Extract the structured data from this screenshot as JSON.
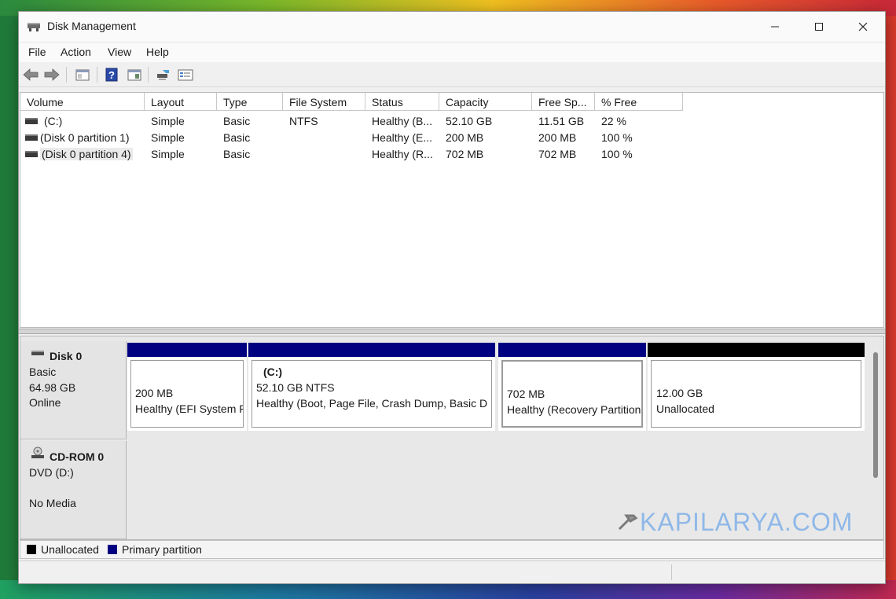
{
  "window": {
    "title": "Disk Management"
  },
  "menu": [
    "File",
    "Action",
    "View",
    "Help"
  ],
  "toolbar": [
    "back-icon",
    "forward-icon",
    "show-hide-console-tree-icon",
    "help-icon",
    "properties-icon",
    "rescan-disks-icon",
    "settings-list-icon"
  ],
  "columns": [
    "Volume",
    "Layout",
    "Type",
    "File System",
    "Status",
    "Capacity",
    "Free Sp...",
    "% Free"
  ],
  "volumes": [
    {
      "volume": "(C:)",
      "layout": "Simple",
      "type": "Basic",
      "fs": "NTFS",
      "status": "Healthy (B...",
      "capacity": "52.10 GB",
      "free": "11.51 GB",
      "pct": "22 %"
    },
    {
      "volume": "(Disk 0 partition 1)",
      "layout": "Simple",
      "type": "Basic",
      "fs": "",
      "status": "Healthy (E...",
      "capacity": "200 MB",
      "free": "200 MB",
      "pct": "100 %"
    },
    {
      "volume": "(Disk 0 partition 4)",
      "layout": "Simple",
      "type": "Basic",
      "fs": "",
      "status": "Healthy (R...",
      "capacity": "702 MB",
      "free": "702 MB",
      "pct": "100 %"
    }
  ],
  "disk0": {
    "name": "Disk 0",
    "type": "Basic",
    "size": "64.98 GB",
    "status": "Online",
    "partitions": [
      {
        "title": "",
        "size": "200 MB",
        "status": "Healthy (EFI System P"
      },
      {
        "title": "(C:)",
        "size": "52.10 GB NTFS",
        "status": "Healthy (Boot, Page File, Crash Dump, Basic D"
      },
      {
        "title": "",
        "size": "702 MB",
        "status": "Healthy (Recovery Partition"
      },
      {
        "title": "",
        "size": "12.00 GB",
        "status": "Unallocated"
      }
    ]
  },
  "cdrom0": {
    "name": "CD-ROM 0",
    "drive": "DVD (D:)",
    "media": "No Media"
  },
  "legend": [
    {
      "label": "Unallocated",
      "color": "#000000"
    },
    {
      "label": "Primary partition",
      "color": "#000080"
    }
  ],
  "watermark": "KAPILARYA.COM",
  "colors": {
    "primary": "#000080",
    "unallocated": "#000000"
  }
}
